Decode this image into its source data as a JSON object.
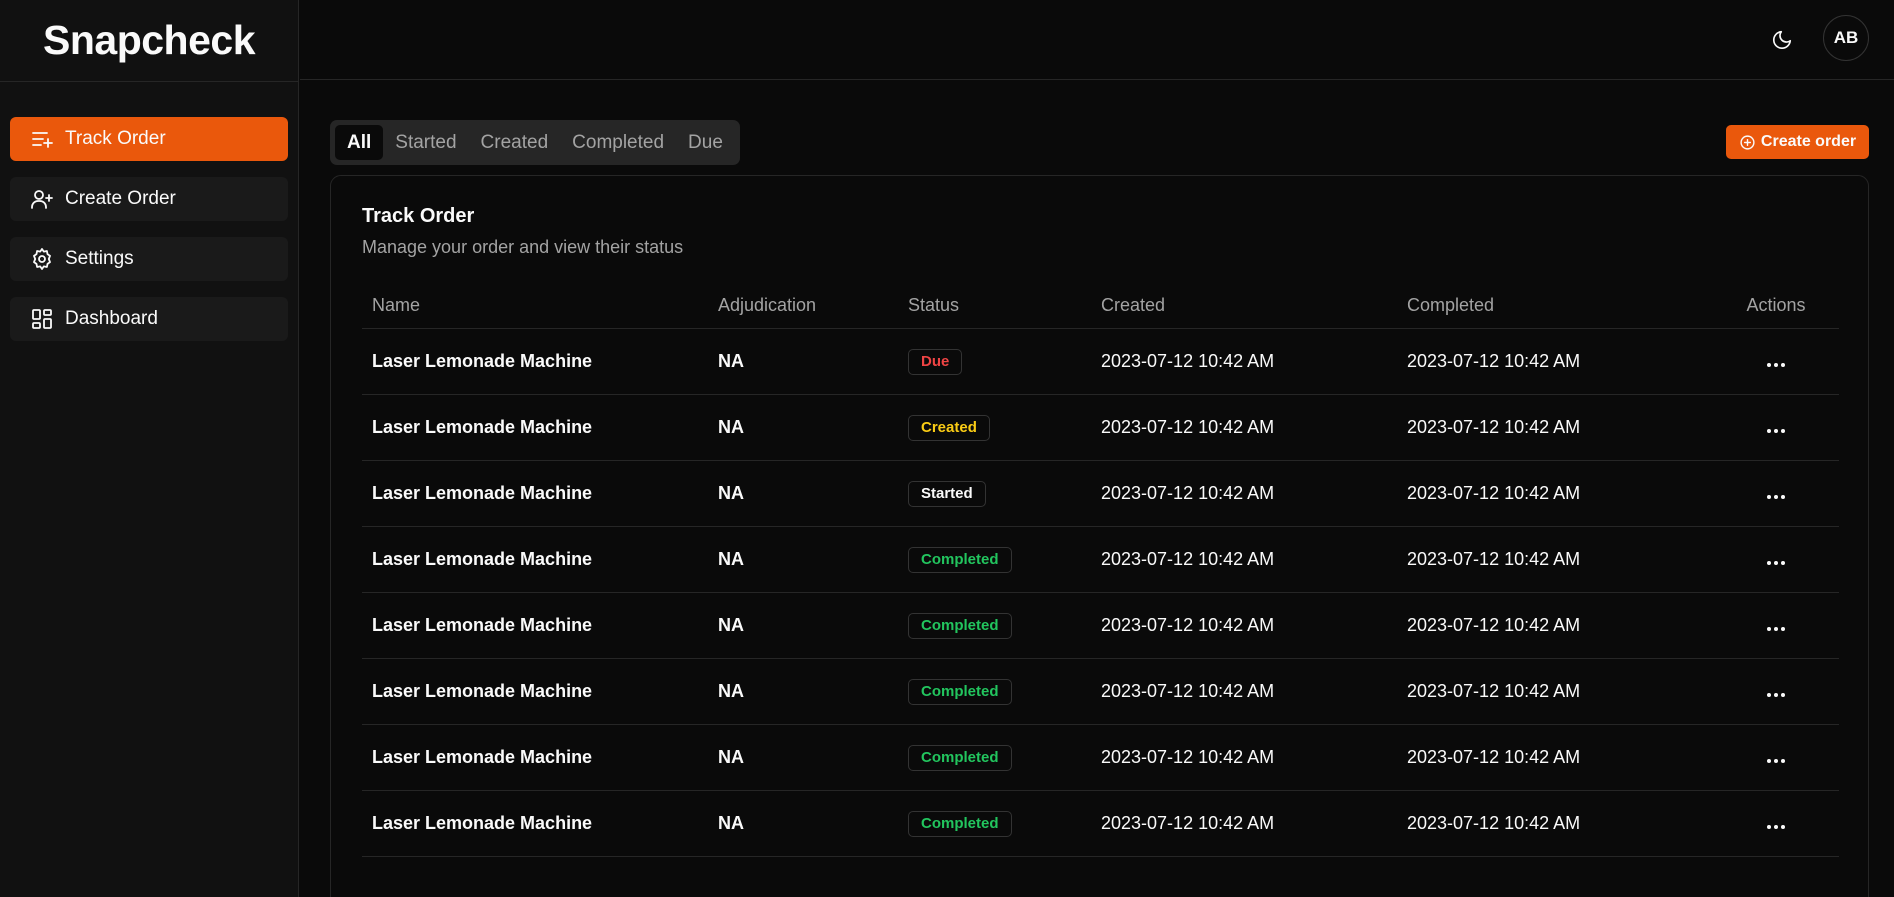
{
  "app": {
    "brand": "Snapcheck"
  },
  "sidebar": {
    "items": [
      {
        "label": "Track Order",
        "icon": "list-plus-icon",
        "active": true
      },
      {
        "label": "Create Order",
        "icon": "user-plus-icon",
        "active": false
      },
      {
        "label": "Settings",
        "icon": "gear-icon",
        "active": false
      },
      {
        "label": "Dashboard",
        "icon": "dashboard-grid-icon",
        "active": false
      }
    ]
  },
  "header": {
    "avatar_initials": "AB",
    "theme_icon": "moon-icon"
  },
  "tabs": [
    {
      "label": "All",
      "active": true
    },
    {
      "label": "Started",
      "active": false
    },
    {
      "label": "Created",
      "active": false
    },
    {
      "label": "Completed",
      "active": false
    },
    {
      "label": "Due",
      "active": false
    }
  ],
  "create_button": {
    "label": "Create order",
    "icon": "plus-circle-icon"
  },
  "card": {
    "title": "Track Order",
    "subtitle": "Manage your order and view their status"
  },
  "table": {
    "columns": [
      "Name",
      "Adjudication",
      "Status",
      "Created",
      "Completed",
      "Actions"
    ],
    "rows": [
      {
        "name": "Laser Lemonade Machine",
        "adjudication": "NA",
        "status": "Due",
        "status_kind": "due",
        "created": "2023-07-12 10:42 AM",
        "completed": "2023-07-12 10:42 AM"
      },
      {
        "name": "Laser Lemonade Machine",
        "adjudication": "NA",
        "status": "Created",
        "status_kind": "created",
        "created": "2023-07-12 10:42 AM",
        "completed": "2023-07-12 10:42 AM"
      },
      {
        "name": "Laser Lemonade Machine",
        "adjudication": "NA",
        "status": "Started",
        "status_kind": "started",
        "created": "2023-07-12 10:42 AM",
        "completed": "2023-07-12 10:42 AM"
      },
      {
        "name": "Laser Lemonade Machine",
        "adjudication": "NA",
        "status": "Completed",
        "status_kind": "completed",
        "created": "2023-07-12 10:42 AM",
        "completed": "2023-07-12 10:42 AM"
      },
      {
        "name": "Laser Lemonade Machine",
        "adjudication": "NA",
        "status": "Completed",
        "status_kind": "completed",
        "created": "2023-07-12 10:42 AM",
        "completed": "2023-07-12 10:42 AM"
      },
      {
        "name": "Laser Lemonade Machine",
        "adjudication": "NA",
        "status": "Completed",
        "status_kind": "completed",
        "created": "2023-07-12 10:42 AM",
        "completed": "2023-07-12 10:42 AM"
      },
      {
        "name": "Laser Lemonade Machine",
        "adjudication": "NA",
        "status": "Completed",
        "status_kind": "completed",
        "created": "2023-07-12 10:42 AM",
        "completed": "2023-07-12 10:42 AM"
      },
      {
        "name": "Laser Lemonade Machine",
        "adjudication": "NA",
        "status": "Completed",
        "status_kind": "completed",
        "created": "2023-07-12 10:42 AM",
        "completed": "2023-07-12 10:42 AM"
      }
    ]
  },
  "colors": {
    "accent": "#ea580c",
    "due": "#ef4444",
    "created": "#facc15",
    "started": "#fafafa",
    "completed": "#22c55e"
  }
}
